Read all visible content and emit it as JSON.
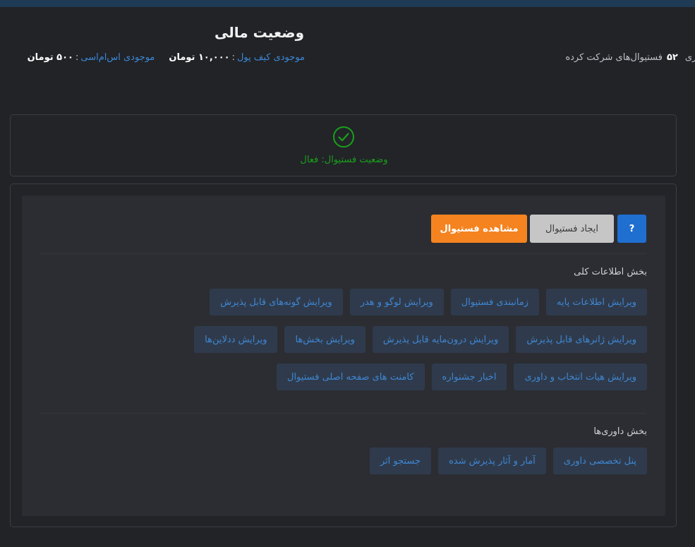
{
  "header": {
    "title": "وضعیت مالی",
    "wallet_label": "موجودی کیف پول",
    "wallet_value": "۱۰,۰۰۰ تومان",
    "sms_label": "موجودی اس‌ام‌اسی",
    "sms_value": "۵۰۰ تومان",
    "separator": ":",
    "festivals_prefix": "هنری",
    "festivals_count": "۵۲",
    "festivals_text": "فستیوال‌های شرکت کرده"
  },
  "status": {
    "icon": "check-circle-icon",
    "text": "وضعیت فستیوال: فعال",
    "color": "#1aa01a"
  },
  "toolbar": {
    "help_label": "?",
    "create_label": "ایجاد فستیوال",
    "view_label": "مشاهده فستیوال"
  },
  "general": {
    "title": "بخش اطلاعات کلی",
    "row1": [
      "ویرایش اطلاعات پایه",
      "زمانبندی فستیوال",
      "ویرایش لوگو و هدر",
      "ویرایش گونه‌های قابل پذیرش"
    ],
    "row2": [
      "ویرایش ژانرهای قابل پذیرش",
      "ویرایش درون‌مایه قابل پذیرش",
      "ویرایش بخش‌ها",
      "ویرایش ددلاین‌ها"
    ],
    "row3": [
      "ویرایش هیات انتخاب و داوری",
      "اخبار جشنواره",
      "کامنت های صفحه اصلی فستیوال"
    ]
  },
  "judging": {
    "title": "بخش داوری‌ها",
    "row1": [
      "پنل تخصصی داوری",
      "آمار و آثار پذیرش شده",
      "جستجو اثر"
    ]
  },
  "colors": {
    "accent_blue": "#1f6fd0",
    "accent_orange": "#f48320",
    "link": "#3f86d3"
  }
}
